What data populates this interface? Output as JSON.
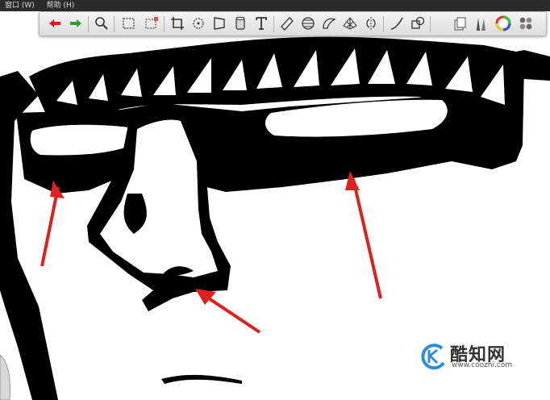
{
  "menu": {
    "window": "窗口 (W)",
    "help": "帮助 (H)"
  },
  "toolbar": {
    "tools": [
      "undo-icon",
      "redo-icon",
      "magnify-icon",
      "rect-select-icon",
      "lasso-select-icon",
      "crop-icon",
      "transform-icon",
      "perspective-icon",
      "paint-bucket-icon",
      "text-icon",
      "ruler-icon",
      "ellipse-guide-icon",
      "french-curve-icon",
      "perspective-grid-icon",
      "symmetry-icon",
      "curve-icon",
      "shape-icon",
      "layers-icon",
      "brush-icon",
      "color-wheel-icon",
      "palette-grid-icon"
    ]
  },
  "colors": {
    "arrow": "#e0201c",
    "ink": "#000000",
    "paper": "#ffffff",
    "menubar": "#2b2b2b"
  },
  "watermark": {
    "brand": "酷知网",
    "url": "www.coozhi.com"
  }
}
